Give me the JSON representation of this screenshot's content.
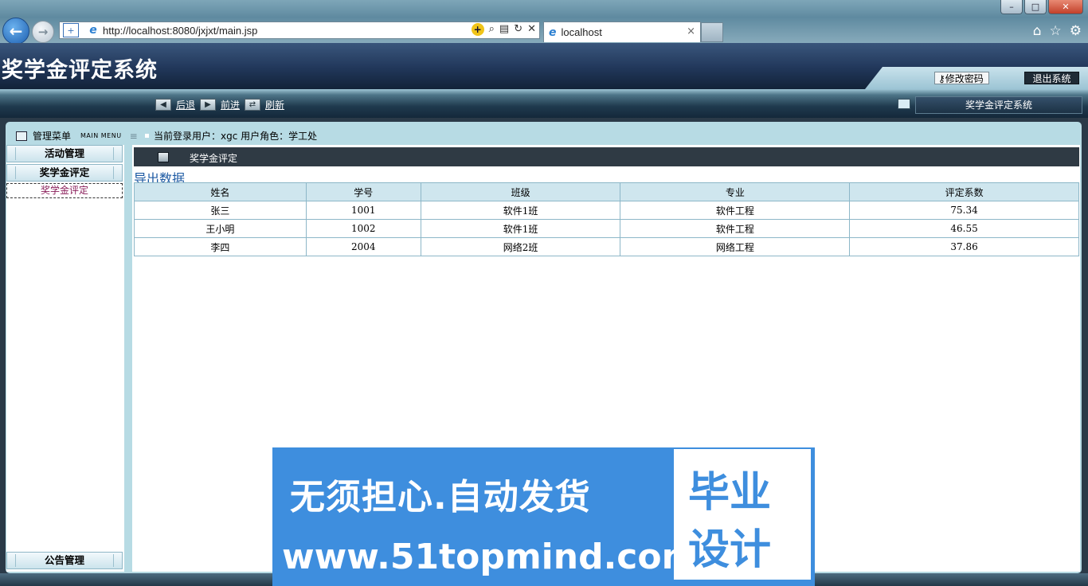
{
  "browser": {
    "url": "http://localhost:8080/jxjxt/main.jsp",
    "tab_title": "localhost",
    "tab_close": "×",
    "back_icon": "←",
    "forward_icon": "→"
  },
  "app": {
    "title": "奖学金评定系统",
    "change_password": "修改密码",
    "logout": "退出系统"
  },
  "toolbar": {
    "back": "后退",
    "forward": "前进",
    "refresh": "刷新",
    "system_name": "奖学金评定系统"
  },
  "menu": {
    "title": "管理菜单",
    "subtitle": "MAIN MENU",
    "user_info": "当前登录用户：xgc 用户角色：学工处",
    "items": [
      {
        "label": "活动管理"
      },
      {
        "label": "奖学金评定"
      },
      {
        "label": "公告管理"
      }
    ],
    "selected_sub_item": "奖学金评定"
  },
  "content": {
    "title": "奖学金评定",
    "export_link": "导出数据",
    "table": {
      "headers": [
        "姓名",
        "学号",
        "班级",
        "专业",
        "评定系数"
      ],
      "rows": [
        [
          "张三",
          "1001",
          "软件1班",
          "软件工程",
          "75.34"
        ],
        [
          "王小明",
          "1002",
          "软件1班",
          "软件工程",
          "46.55"
        ],
        [
          "李四",
          "2004",
          "网络2班",
          "网络工程",
          "37.86"
        ]
      ]
    }
  },
  "watermark": {
    "line1": "无须担心.自动发货",
    "line2": "www.51topmind.com",
    "box_line1": "毕业",
    "box_line2": "设计"
  }
}
